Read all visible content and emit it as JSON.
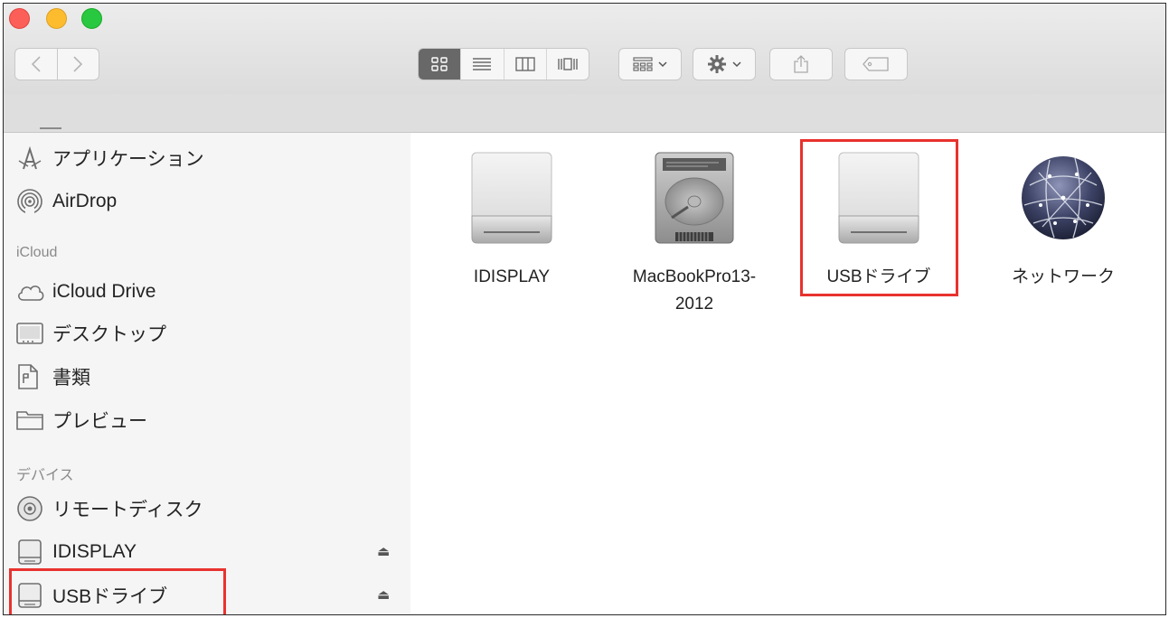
{
  "window": {
    "sidebar": {
      "favorites": [
        {
          "label": "アプリケーション",
          "icon": "applications-icon"
        },
        {
          "label": "AirDrop",
          "icon": "airdrop-icon"
        }
      ],
      "icloud_header": "iCloud",
      "icloud": [
        {
          "label": "iCloud Drive",
          "icon": "cloud-icon"
        },
        {
          "label": "デスクトップ",
          "icon": "desktop-icon"
        },
        {
          "label": "書類",
          "icon": "documents-icon"
        },
        {
          "label": "プレビュー",
          "icon": "folder-icon"
        }
      ],
      "devices_header": "デバイス",
      "devices": [
        {
          "label": "リモートディスク",
          "icon": "remote-disc-icon"
        },
        {
          "label": "IDISPLAY",
          "icon": "drive-icon",
          "eject": "⏏"
        },
        {
          "label": "USBドライブ",
          "icon": "drive-icon",
          "eject": "⏏"
        }
      ]
    },
    "content": {
      "items": [
        {
          "label": "IDISPLAY",
          "icon": "external-drive-icon"
        },
        {
          "label": "MacBookPro13-2012",
          "icon": "internal-hard-drive-icon"
        },
        {
          "label": "USBドライブ",
          "icon": "external-drive-icon"
        },
        {
          "label": "ネットワーク",
          "icon": "network-globe-icon"
        }
      ]
    },
    "highlight_color": "#e8322e"
  }
}
